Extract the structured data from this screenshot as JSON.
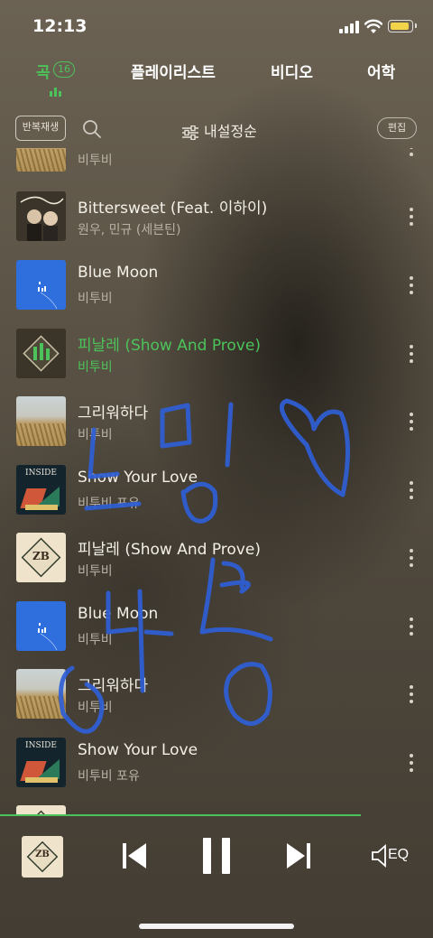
{
  "status": {
    "time": "12:13"
  },
  "tabs": [
    {
      "label": "곡",
      "count": "16",
      "active": true
    },
    {
      "label": "플레이리스트"
    },
    {
      "label": "비디오"
    },
    {
      "label": "어학"
    }
  ],
  "toolbar": {
    "repeat_label": "반복재생",
    "sort_label": "내설정순",
    "edit_label": "편집"
  },
  "songs": [
    {
      "title": "",
      "artist": "비투비",
      "cover": "field-icon"
    },
    {
      "title": "Bittersweet (Feat. 이하이)",
      "artist": "원우, 민규 (세븐틴)",
      "cover": "bittersweet-cover"
    },
    {
      "title": "Blue Moon",
      "artist": "비투비",
      "cover": "blue-moon-cover"
    },
    {
      "title": "피날레 (Show And Prove)",
      "artist": "비투비",
      "cover": "zb-cover",
      "playing": true
    },
    {
      "title": "그리워하다",
      "artist": "비투비",
      "cover": "field-cover"
    },
    {
      "title": "Show Your Love",
      "artist": "비투비 포유",
      "cover": "inside-cover"
    },
    {
      "title": "피날레 (Show And Prove)",
      "artist": "비투비",
      "cover": "zb-cover"
    },
    {
      "title": "Blue Moon",
      "artist": "비투비",
      "cover": "blue-moon-cover"
    },
    {
      "title": "그리워하다",
      "artist": "비투비",
      "cover": "field-cover"
    },
    {
      "title": "Show Your Love",
      "artist": "비투비 포유",
      "cover": "inside-cover"
    }
  ],
  "album_text": {
    "zb": "ZB",
    "inside": "INSIDE"
  },
  "player": {
    "eq_label": "EQ",
    "state": "playing"
  },
  "colors": {
    "accent": "#4cc35a",
    "scribble": "#2f5fd6"
  }
}
